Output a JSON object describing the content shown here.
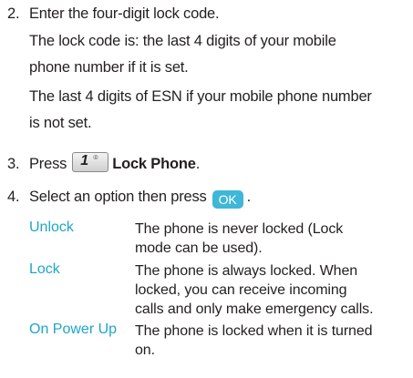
{
  "colors": {
    "text": "#231f20",
    "option_label": "#1ea6c8",
    "ok_button": "#3fb7d6"
  },
  "step2": {
    "number": "2.",
    "text": "Enter the four-digit lock code.",
    "para1_line1": "The lock code is: the last 4 digits of your mobile",
    "para1_line2": "phone number if it is set.",
    "para2_line1": "The last 4 digits of ESN if your mobile phone number",
    "para2_line2": "is not set."
  },
  "step3": {
    "number": "3.",
    "prefix": "Press",
    "key_digit": "1",
    "key_symbol": "⌾",
    "bold_text": "Lock Phone",
    "suffix": "."
  },
  "step4": {
    "number": "4.",
    "text": "Select an option then press",
    "ok_label": "OK",
    "suffix": "."
  },
  "options": [
    {
      "label": "Unlock",
      "desc_line1": "The phone is never locked (Lock",
      "desc_line2": "mode can be used)."
    },
    {
      "label": "Lock",
      "desc_line1": "The phone is always locked. When",
      "desc_line2": "locked, you can receive incoming",
      "desc_line3": "calls and only make emergency calls."
    },
    {
      "label": "On Power Up",
      "desc_line1": "The phone is locked when it is turned",
      "desc_line2": "on."
    }
  ]
}
